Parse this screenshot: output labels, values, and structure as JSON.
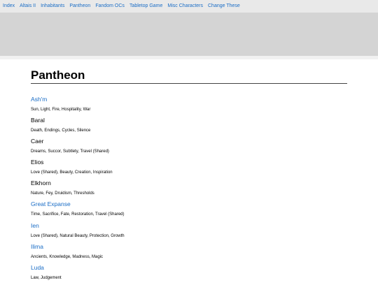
{
  "nav": {
    "items": [
      "Index",
      "Altais II",
      "Inhabitants",
      "Pantheon",
      "Fandom OCs",
      "Tabletop Game",
      "Misc Characters",
      "Change These"
    ]
  },
  "page": {
    "title": "Pantheon"
  },
  "deities": [
    {
      "name": "Ash'm",
      "link": true,
      "domains": "Sun, Light, Fire, Hospitality, War"
    },
    {
      "name": "Baral",
      "link": false,
      "domains": "Death, Endings, Cycles, Silence"
    },
    {
      "name": "Caer",
      "link": false,
      "domains": "Dreams, Succor, Subtlety, Travel (Shared)"
    },
    {
      "name": "Elios",
      "link": false,
      "domains": "Love (Shared), Beauty, Creation, Inspiration"
    },
    {
      "name": "Elkhorn",
      "link": false,
      "domains": "Nature, Fey, Druidism, Thresholds"
    },
    {
      "name": "Great Expanse",
      "link": true,
      "domains": "Time, Sacrifice, Fate, Restoration, Travel (Shared)"
    },
    {
      "name": "Ien",
      "link": true,
      "domains": "Love (Shared), Natural Beauty, Protection, Growth"
    },
    {
      "name": "Ilima",
      "link": true,
      "domains": "Ancients, Knowledge, Madness, Magic"
    },
    {
      "name": "Luda",
      "link": true,
      "domains": "Law, Judgement"
    }
  ],
  "colors": {
    "link": "#1a6dc6",
    "nav_bg": "#e9e9e9",
    "banner": "#d4d4d4"
  }
}
